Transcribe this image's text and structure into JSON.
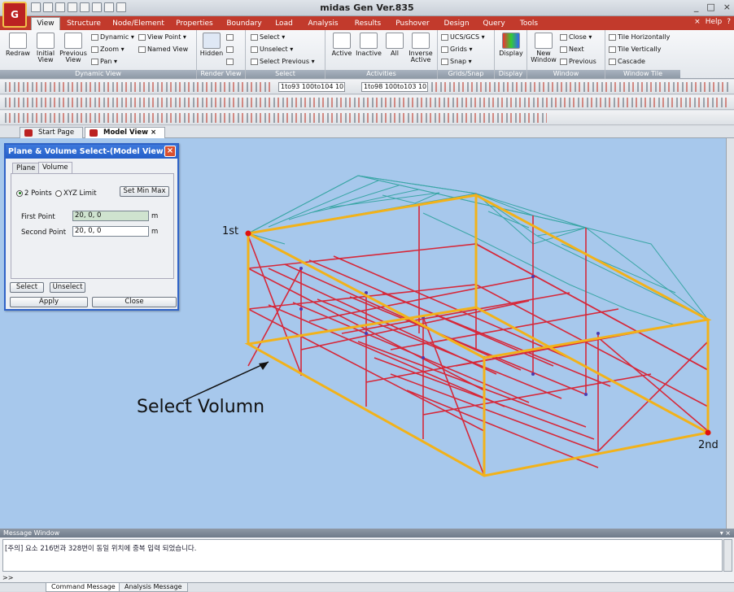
{
  "app": {
    "logo": "G",
    "title": "midas Gen Ver.835",
    "help": "Help"
  },
  "window_controls": [
    "_",
    "□",
    "×"
  ],
  "menu": {
    "tabs": [
      "View",
      "Structure",
      "Node/Element",
      "Properties",
      "Boundary",
      "Load",
      "Analysis",
      "Results",
      "Pushover",
      "Design",
      "Query",
      "Tools"
    ],
    "active": "View"
  },
  "ribbon": {
    "dynamic_view": {
      "label": "Dynamic View",
      "redraw": "Redraw",
      "initial_view": "Initial\nView",
      "previous_view": "Previous\nView",
      "dynamic": "Dynamic",
      "zoom": "Zoom",
      "pan": "Pan",
      "view_point": "View Point",
      "named_view": "Named View"
    },
    "render_view": {
      "label": "Render View",
      "hidden": "Hidden"
    },
    "select": {
      "label": "Select",
      "select": "Select",
      "unselect": "Unselect",
      "select_previous": "Select Previous"
    },
    "activities": {
      "label": "Activities",
      "active": "Active",
      "inactive": "Inactive",
      "all": "All",
      "inverse_active": "Inverse\nActive"
    },
    "grids_snap": {
      "label": "Grids/Snap",
      "ucs_gcs": "UCS/GCS",
      "grids": "Grids",
      "snap": "Snap"
    },
    "display": {
      "label": "Display",
      "display": "Display"
    },
    "window": {
      "label": "Window",
      "new_window": "New\nWindow",
      "close": "Close",
      "next": "Next",
      "previous": "Previous"
    },
    "window_tile": {
      "label": "Window Tile",
      "tile_h": "Tile Horizontally",
      "tile_v": "Tile Vertically",
      "cascade": "Cascade"
    }
  },
  "toolbar": {
    "combo1": "1to93 100to104 10",
    "combo2": "1to98 100to103 10"
  },
  "doc_tabs": [
    {
      "label": "Start Page"
    },
    {
      "label": "Model View"
    }
  ],
  "dialog": {
    "title": "Plane & Volume Select-(Model View)",
    "tabs": [
      "Plane",
      "Volume"
    ],
    "active_tab": "Volume",
    "radio_2points": "2 Points",
    "radio_xyz": "XYZ Limit",
    "set_min_max": "Set Min Max",
    "first_point_label": "First Point",
    "first_point_value": "20, 0, 0",
    "second_point_label": "Second Point",
    "second_point_value": "20, 0, 0",
    "unit": "m",
    "select": "Select",
    "unselect": "Unselect",
    "apply": "Apply",
    "close": "Close"
  },
  "annotations": {
    "first": "1st",
    "second": "2nd",
    "select_volumn": "Select Volumn"
  },
  "message_window": {
    "title": "Message Window",
    "message": "[주의] 요소 216번과 328번이 동일 위치에 중복 입력 되었습니다.",
    "prompt": ">>",
    "tabs": [
      "Command Message",
      "Analysis Message"
    ]
  },
  "colors": {
    "accent": "#c23a2c",
    "viewport": "#a7c8ec",
    "frame": "#d6283a",
    "truss": "#3aa6a6",
    "volume_box": "#f2b21a",
    "point": "#e01010"
  }
}
